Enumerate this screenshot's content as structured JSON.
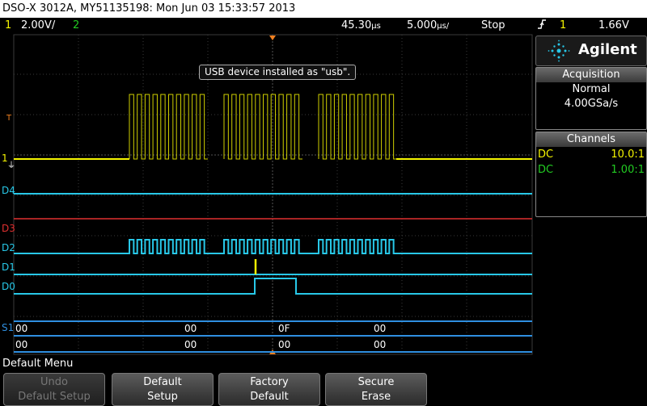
{
  "title": "DSO-X 3012A, MY51135198: Mon Jun 03 15:33:57 2013",
  "status": {
    "ch1_num": "1",
    "ch1_scale": "2.00V/",
    "ch2_num": "2",
    "time_delay": "45.30",
    "time_delay_unit": "µs",
    "time_scale": "5.000",
    "time_scale_unit": "µs/",
    "run_state": "Stop",
    "trigger_icon": "trigger-edge-icon",
    "trigger_src": "1",
    "trigger_level": "1.66V"
  },
  "brand": {
    "name": "Agilent",
    "icon": "agilent-spark-icon"
  },
  "acquisition": {
    "header": "Acquisition",
    "mode": "Normal",
    "rate": "4.00GSa/s"
  },
  "channels": {
    "header": "Channels",
    "rows": [
      {
        "coupling": "DC",
        "probe": "10.0:1",
        "color": "#f5f500"
      },
      {
        "coupling": "DC",
        "probe": "1.00:1",
        "color": "#22cc22"
      }
    ]
  },
  "message": "USB device installed as \"usb\".",
  "trace_labels": {
    "ch1": "1",
    "trig": "T",
    "d4": "D4",
    "d3": "D3",
    "d2": "D2",
    "d1": "D1",
    "d0": "D0",
    "s1": "S1"
  },
  "bus": {
    "row1": [
      "00",
      "00",
      "0F",
      "00"
    ],
    "row2": [
      "00",
      "00",
      "00",
      "00"
    ]
  },
  "menu_title": "Default Menu",
  "softkeys": [
    {
      "line1": "Undo",
      "line2": "Default Setup",
      "enabled": false
    },
    {
      "line1": "Default",
      "line2": "Setup",
      "enabled": true
    },
    {
      "line1": "Factory",
      "line2": "Default",
      "enabled": true
    },
    {
      "line1": "Secure",
      "line2": "Erase",
      "enabled": true
    }
  ],
  "colors": {
    "ch1": "#f5f500",
    "ch2": "#22cc22",
    "digital": "#28c8e8",
    "d3": "#e03030",
    "bus": "#2f8fe0"
  }
}
